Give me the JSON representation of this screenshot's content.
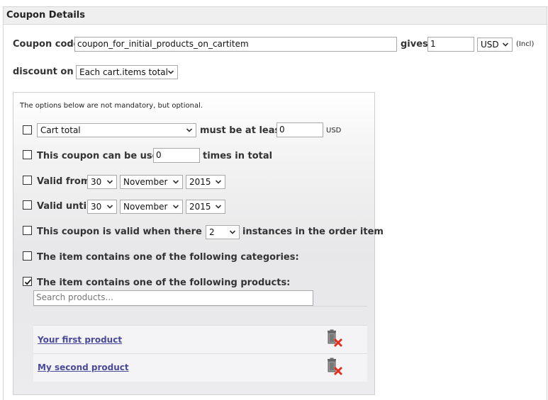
{
  "section_title": "Coupon Details",
  "coupon": {
    "code_label": "Coupon code",
    "code_value": "coupon_for_initial_products_on_cartitem",
    "gives_label": "gives",
    "gives_value": "1",
    "currency": "USD",
    "incl_note": "(Incl)"
  },
  "discount": {
    "label": "discount on",
    "value": "Each cart.items total"
  },
  "options": {
    "note": "The options below are not mandatory, but optional.",
    "cart_total": {
      "select_value": "Cart total",
      "label": "must be at least",
      "value": "0",
      "unit": "USD",
      "checked": false
    },
    "usage": {
      "label_before": "This coupon can be used",
      "value": "0",
      "label_after": "times in total",
      "checked": false
    },
    "valid_from": {
      "label": "Valid from",
      "day": "30",
      "month": "November",
      "year": "2015",
      "checked": false
    },
    "valid_until": {
      "label": "Valid until",
      "day": "30",
      "month": "November",
      "year": "2015",
      "checked": false
    },
    "instances": {
      "label_before": "This coupon is valid when there are",
      "value": "2",
      "label_after": "instances in the order item",
      "checked": false
    },
    "categories": {
      "label": "The item contains one of the following categories:",
      "checked": false
    },
    "products": {
      "label": "The item contains one of the following products:",
      "checked": true,
      "search_placeholder": "Search products...",
      "items": [
        {
          "name": "Your first product"
        },
        {
          "name": "My second product"
        }
      ]
    }
  },
  "colors": {
    "link": "#4a4a9a",
    "trash_x": "#e0301e"
  },
  "icons": {
    "dropdown": "chevron-down-icon",
    "checkbox_checked": "checkmark-icon",
    "remove": "trash-delete-icon"
  }
}
